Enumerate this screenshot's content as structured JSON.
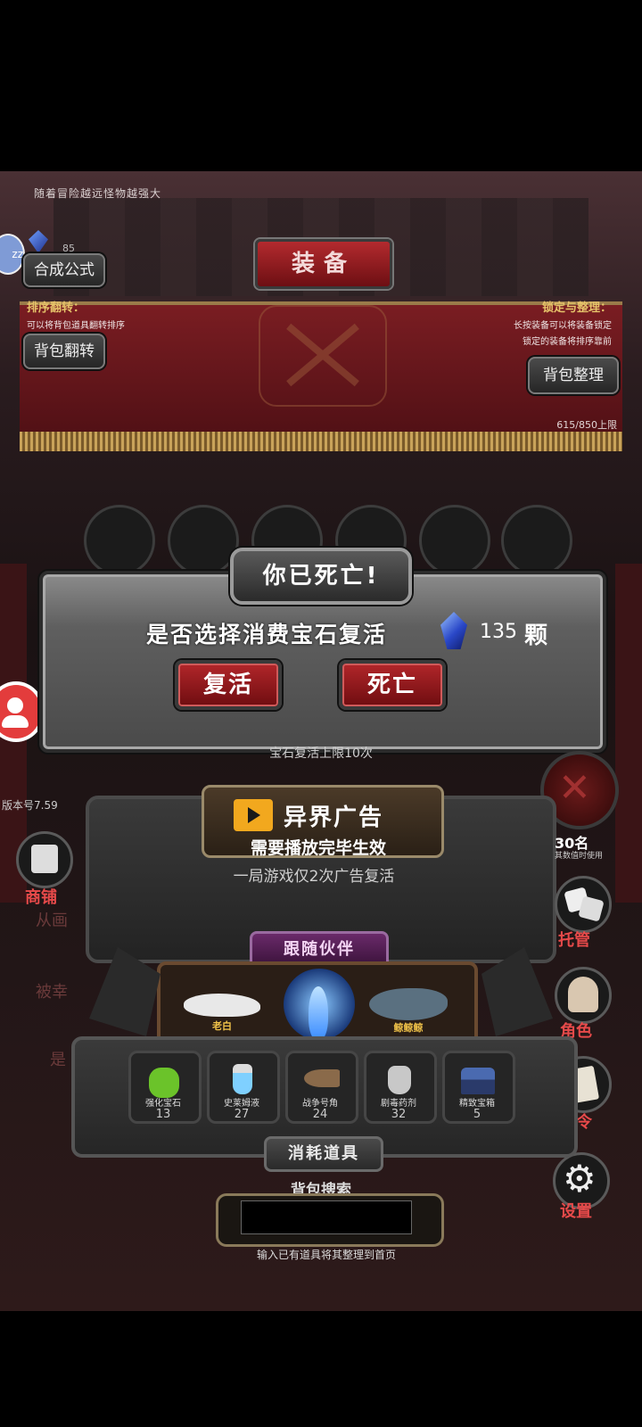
{
  "header": {
    "tip": "随着冒险越远怪物越强大",
    "title": "装备",
    "gem_count_small": "85",
    "avatar_badge": "zz"
  },
  "toolbar": {
    "craft_label": "合成公式",
    "sort_title": "排序翻转：",
    "sort_desc": "可以将背包道具翻转排序",
    "bag_flip_label": "背包翻转",
    "lock_title": "锁定与整理：",
    "lock_desc1": "长按装备可以将装备锁定",
    "lock_desc2": "锁定的装备将排序靠前",
    "bag_sort_label": "背包整理",
    "capacity": "615/850上限"
  },
  "death_dialog": {
    "title": "你已死亡!",
    "question": "是否选择消费宝石复活",
    "gem_amount": "135",
    "gem_unit": "颗",
    "revive_label": "复活",
    "die_label": "死亡",
    "revive_limit": "宝石复活上限10次"
  },
  "ad_revive": {
    "title": "异界广告",
    "subtitle": "需要播放完毕生效",
    "note": "一局游戏仅2次广告复活"
  },
  "version": "版本号7.59",
  "side_left": {
    "shop_label": "商铺",
    "faded_1": "从画",
    "faded_2": "被幸",
    "faded_3": "是"
  },
  "side_right": {
    "counter": "30名",
    "counter_note": "其数值时使用",
    "dice_label": "托管",
    "role_label": "角色",
    "code_label": "口令",
    "settings_label": "设置"
  },
  "companions": {
    "header": "跟随伙伴",
    "items": [
      {
        "name": "老白"
      },
      {
        "name": ""
      },
      {
        "name": "鲸鲸鲸"
      }
    ]
  },
  "consumables": {
    "header": "消耗道具",
    "items": [
      {
        "name": "强化宝石",
        "count": "13"
      },
      {
        "name": "史莱姆液",
        "count": "27"
      },
      {
        "name": "战争号角",
        "count": "24"
      },
      {
        "name": "剧毒药剂",
        "count": "32"
      },
      {
        "name": "精致宝箱",
        "count": "5"
      }
    ]
  },
  "search": {
    "label": "背包搜索",
    "placeholder": "",
    "hint": "输入已有道具将其整理到首页"
  },
  "colors": {
    "accent_red": "#b2262a",
    "gold": "#e6c36a",
    "panel_grey": "#6b6b6b"
  }
}
